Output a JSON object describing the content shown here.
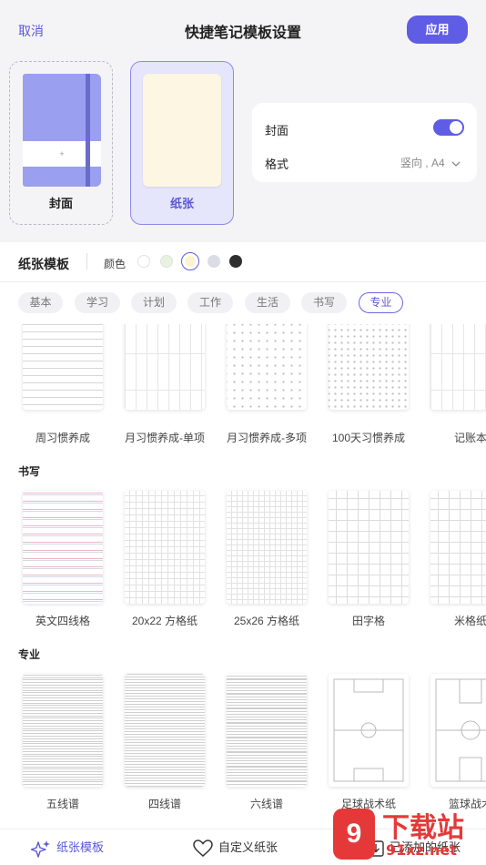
{
  "header": {
    "cancel": "取消",
    "title": "快捷笔记模板设置",
    "apply": "应用"
  },
  "cards": {
    "cover_label": "封面",
    "cover_center_mark": "+",
    "paper_label": "纸张"
  },
  "settings": {
    "cover_label": "封面",
    "cover_enabled": true,
    "format_label": "格式",
    "format_value": "竖向 , A4"
  },
  "templates": {
    "title": "纸张模板",
    "color_label": "颜色",
    "colors": [
      "#ffffff",
      "#e7f2e3",
      "#fdf3cf",
      "#dcdce6",
      "#2f2f2f"
    ],
    "selected_color_index": 2,
    "categories": [
      "基本",
      "学习",
      "计划",
      "工作",
      "生活",
      "书写",
      "专业"
    ],
    "active_category": "专业"
  },
  "rows": {
    "habit": {
      "items": [
        "周习惯养成",
        "月习惯养成-单项",
        "月习惯养成-多项",
        "100天习惯养成",
        "记账本"
      ]
    },
    "writing": {
      "title": "书写",
      "items": [
        "英文四线格",
        "20x22 方格纸",
        "25x26 方格纸",
        "田字格",
        "米格纸"
      ]
    },
    "pro": {
      "title": "专业",
      "items": [
        "五线谱",
        "四线谱",
        "六线谱",
        "足球战术纸",
        "篮球战术"
      ]
    }
  },
  "bottom": {
    "tab1": "纸张模板",
    "tab2": "自定义纸张",
    "tab3": "已添加的纸张"
  },
  "watermark": {
    "badge": "9",
    "brand": "下载站",
    "url": "91xz.net"
  }
}
